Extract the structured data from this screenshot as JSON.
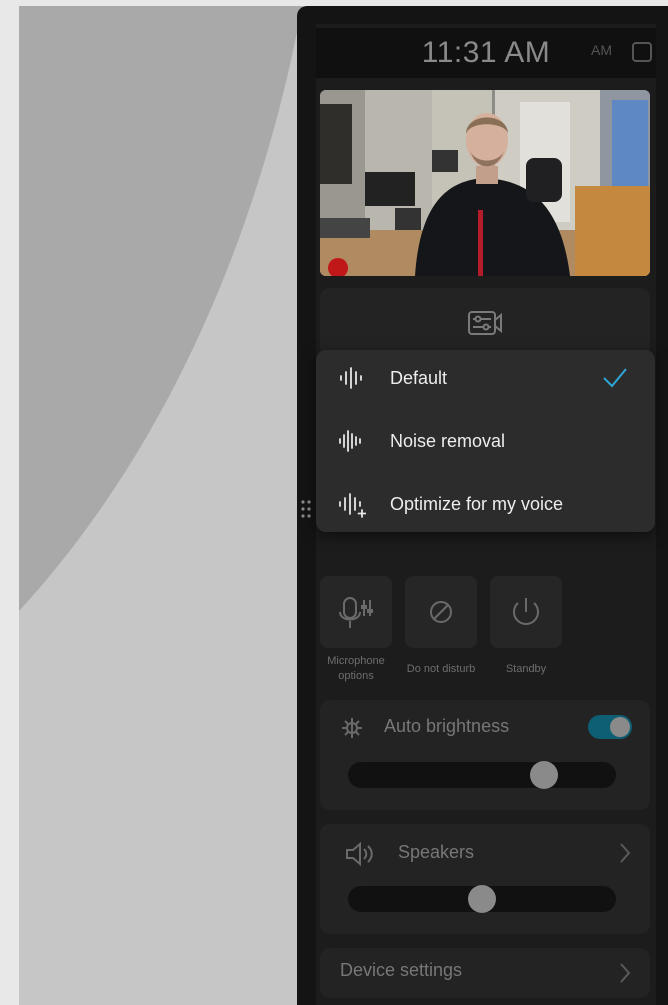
{
  "status_bar": {
    "time": "11:31 AM",
    "ghost_text": "AM"
  },
  "camera_card": {
    "icon": "camera-settings-icon"
  },
  "mic_mode_menu": {
    "items": [
      {
        "label": "Default",
        "icon": "waveform-icon",
        "selected": true
      },
      {
        "label": "Noise removal",
        "icon": "noise-removal-icon",
        "selected": false
      },
      {
        "label": "Optimize for my voice",
        "icon": "voice-optimize-icon",
        "selected": false
      }
    ],
    "accent_color": "#2fa6d8"
  },
  "quick_actions": [
    {
      "label": "Microphone options",
      "icon": "microphone-options-icon"
    },
    {
      "label": "Do not disturb",
      "icon": "do-not-disturb-icon"
    },
    {
      "label": "Standby",
      "icon": "power-icon"
    }
  ],
  "brightness": {
    "label": "Auto brightness",
    "auto_enabled": true,
    "level": 0.76
  },
  "speakers": {
    "label": "Speakers",
    "volume": 0.5
  },
  "device_settings": {
    "label": "Device settings"
  }
}
